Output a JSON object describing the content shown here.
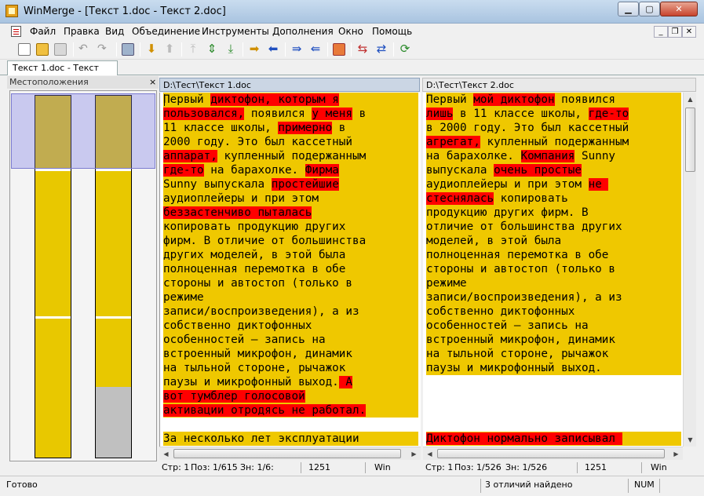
{
  "window": {
    "title": "WinMerge - [Текст 1.doc - Текст 2.doc]",
    "min": "0",
    "max": "1",
    "close": "r"
  },
  "menu": [
    "Файл",
    "Правка",
    "Вид",
    "Объединение",
    "Инструменты",
    "Дополнения",
    "Окно",
    "Помощь"
  ],
  "mdi": {
    "min": "_",
    "restore": "❐",
    "close": "✕"
  },
  "toolbar_icons": [
    "new-icon",
    "open-icon",
    "save-icon",
    "undo-icon",
    "redo-icon",
    "bookmarks-icon",
    "next-diff-icon",
    "prev-diff-icon",
    "first-diff-icon",
    "current-diff-icon",
    "last-diff-icon",
    "copy-right-icon",
    "copy-left-icon",
    "copy-right-advance-icon",
    "copy-left-advance-icon",
    "options-icon",
    "compare-icon",
    "refresh-icon"
  ],
  "tab": {
    "label": "Текст 1.doc - Текст 2.doc"
  },
  "location_pane": {
    "title": "Местоположения",
    "close": "×",
    "right_gray_from": 0.805
  },
  "left_pane": {
    "path": "D:\\Тест\\Текст 1.doc",
    "lines": [
      [
        [
          "Первый ",
          0
        ],
        [
          "диктофон, которым я",
          1
        ]
      ],
      [
        [
          "пользовался,",
          1
        ],
        [
          " появился ",
          0
        ],
        [
          "у меня",
          1
        ],
        [
          " в",
          0
        ]
      ],
      [
        [
          "11 классе школы, ",
          0
        ],
        [
          "примерно",
          1
        ],
        [
          " в",
          0
        ]
      ],
      [
        [
          "2000 году. Это был кассетный",
          0
        ]
      ],
      [
        [
          "аппарат,",
          1
        ],
        [
          " купленный подержанным",
          0
        ]
      ],
      [
        [
          "где-то",
          1
        ],
        [
          " на барахолке. ",
          0
        ],
        [
          "Фирма",
          1
        ]
      ],
      [
        [
          "Sunny выпускала ",
          0
        ],
        [
          "простейшие",
          1
        ]
      ],
      [
        [
          "аудиоплейеры и при этом",
          0
        ]
      ],
      [
        [
          "беззастенчиво пыталась",
          1
        ]
      ],
      [
        [
          "копировать продукцию других",
          0
        ]
      ],
      [
        [
          "фирм. В отличие от большинства",
          0
        ]
      ],
      [
        [
          "других моделей, в этой была",
          0
        ]
      ],
      [
        [
          "полноценная перемотка в обе",
          0
        ]
      ],
      [
        [
          "стороны и автостоп (только в",
          0
        ]
      ],
      [
        [
          "режиме",
          0
        ]
      ],
      [
        [
          "записи/воспроизведения), а из",
          0
        ]
      ],
      [
        [
          "собственно диктофонных",
          0
        ]
      ],
      [
        [
          "особенностей – запись на",
          0
        ]
      ],
      [
        [
          "встроенный микрофон, динамик",
          0
        ]
      ],
      [
        [
          "на тыльной стороне, рычажок",
          0
        ]
      ],
      [
        [
          "паузы и микрофонный выход.",
          0
        ],
        [
          " А",
          1
        ]
      ],
      [
        [
          "вот тумблер голосовой",
          1
        ]
      ],
      [
        [
          "активации отродясь не работал.",
          1
        ]
      ],
      [],
      [
        [
          "За несколько лет эксплуатации",
          0
        ]
      ]
    ]
  },
  "right_pane": {
    "path": "D:\\Тест\\Текст 2.doc",
    "lines": [
      [
        [
          "Первый ",
          0
        ],
        [
          "мой диктофон",
          1
        ],
        [
          " появился",
          0
        ]
      ],
      [
        [
          "лишь",
          1
        ],
        [
          " в 11 классе школы, ",
          0
        ],
        [
          "где-то",
          1
        ]
      ],
      [
        [
          "в 2000 году. Это был кассетный",
          0
        ]
      ],
      [
        [
          "агрегат,",
          1
        ],
        [
          " купленный подержанным",
          0
        ]
      ],
      [
        [
          "на барахолке. ",
          0
        ],
        [
          "Компания",
          1
        ],
        [
          " Sunny",
          0
        ]
      ],
      [
        [
          "выпускала ",
          0
        ],
        [
          "очень простые",
          1
        ]
      ],
      [
        [
          "аудиоплейеры и при этом ",
          0
        ],
        [
          "не ",
          1
        ]
      ],
      [
        [
          "стеснялась",
          1
        ],
        [
          " копировать",
          0
        ]
      ],
      [
        [
          "продукцию других фирм. В",
          0
        ]
      ],
      [
        [
          "отличие от большинства других",
          0
        ]
      ],
      [
        [
          "моделей, в этой была",
          0
        ]
      ],
      [
        [
          "полноценная перемотка в обе",
          0
        ]
      ],
      [
        [
          "стороны и автостоп (только в",
          0
        ]
      ],
      [
        [
          "режиме",
          0
        ]
      ],
      [
        [
          "записи/воспроизведения), а из",
          0
        ]
      ],
      [
        [
          "собственно диктофонных",
          0
        ]
      ],
      [
        [
          "особенностей – запись на",
          0
        ]
      ],
      [
        [
          "встроенный микрофон, динамик",
          0
        ]
      ],
      [
        [
          "на тыльной стороне, рычажок",
          0
        ]
      ],
      [
        [
          "паузы и микрофонный выход.",
          0
        ]
      ],
      [],
      [],
      [],
      [],
      [
        [
          "Диктофон нормально записывал ",
          1
        ]
      ]
    ]
  },
  "left_status": {
    "line": "Стр: 1",
    "pos": "Поз: 1/615",
    "char": "Зн: 1/6:",
    "codepage": "1251",
    "eol": "Win"
  },
  "right_status": {
    "line": "Стр: 1",
    "pos": "Поз: 1/526",
    "char": "Зн: 1/526",
    "codepage": "1251",
    "eol": "Win"
  },
  "statusbar": {
    "ready": "Готово",
    "diffs": "3 отличий найдено",
    "num": "NUM"
  }
}
